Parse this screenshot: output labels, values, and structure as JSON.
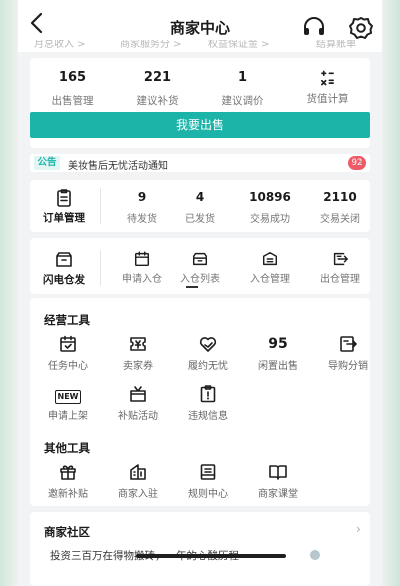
{
  "header": {
    "title": "商家中心"
  },
  "peek_items": [
    "月总收入 >",
    "商家服务分 >",
    "权益保证金 >",
    "结算账单"
  ],
  "stats": [
    {
      "value": "165",
      "label": "出售管理"
    },
    {
      "value": "221",
      "label": "建议补货"
    },
    {
      "value": "1",
      "label": "建议调价"
    },
    {
      "value": "",
      "label": "货值计算",
      "icon": "calculator-icon"
    }
  ],
  "sell_button": "我要出售",
  "notice": {
    "tag": "公告",
    "text": "美妆售后无忧活动通知",
    "badge": "92"
  },
  "orders": {
    "label": "订单管理",
    "cells": [
      {
        "value": "9",
        "label": "待发货"
      },
      {
        "value": "4",
        "label": "已发货"
      },
      {
        "value": "10896",
        "label": "交易成功"
      },
      {
        "value": "2110",
        "label": "交易关闭"
      }
    ]
  },
  "flash": {
    "label": "闪电仓发",
    "cells": [
      {
        "label": "申请入仓",
        "icon": "calendar-icon"
      },
      {
        "label": "入仓列表",
        "icon": "tray-icon"
      },
      {
        "label": "入仓管理",
        "icon": "document-icon"
      },
      {
        "label": "出仓管理",
        "icon": "export-icon"
      }
    ]
  },
  "business_tools": {
    "title": "经营工具",
    "items": [
      {
        "label": "任务中心",
        "icon": "calendar-check-icon"
      },
      {
        "label": "卖家券",
        "icon": "coupon-icon"
      },
      {
        "label": "履约无忧",
        "icon": "heart-hands-icon"
      },
      {
        "label": "闲置出售",
        "icon": "idle-95-icon",
        "glyph": "95"
      },
      {
        "label": "导购分销",
        "icon": "share-icon"
      },
      {
        "label": "申请上架",
        "icon": "new-icon",
        "glyph": "NEW"
      },
      {
        "label": "补贴活动",
        "icon": "gift-box-icon"
      },
      {
        "label": "违规信息",
        "icon": "warning-clipboard-icon"
      }
    ]
  },
  "other_tools": {
    "title": "其他工具",
    "items": [
      {
        "label": "邀新补贴",
        "icon": "gift-icon"
      },
      {
        "label": "商家入驻",
        "icon": "store-icon"
      },
      {
        "label": "规则中心",
        "icon": "rules-icon"
      },
      {
        "label": "商家课堂",
        "icon": "book-icon"
      }
    ]
  },
  "community": {
    "title": "商家社区",
    "post": "投资三百万在得物搬砖，一年的心酸历程"
  }
}
